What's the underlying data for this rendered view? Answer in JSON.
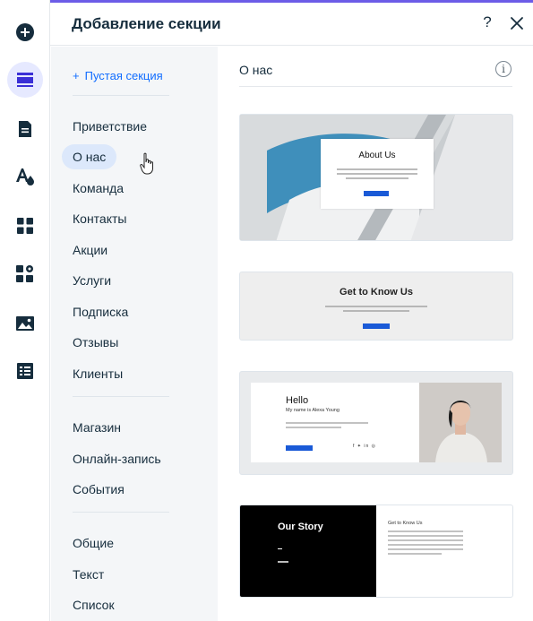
{
  "rail": {
    "items": [
      {
        "icon": "add-icon"
      },
      {
        "icon": "sections-icon",
        "active": true
      },
      {
        "icon": "page-icon"
      },
      {
        "icon": "design-icon"
      },
      {
        "icon": "apps-icon"
      },
      {
        "icon": "plugins-icon"
      },
      {
        "icon": "media-icon"
      },
      {
        "icon": "table-icon"
      }
    ]
  },
  "header": {
    "title": "Добавление секции",
    "help_label": "?"
  },
  "categories": {
    "add_empty_label": "Пустая секция",
    "add_empty_plus": "+",
    "group1": [
      "Приветствие",
      "О нас",
      "Команда",
      "Контакты",
      "Акции",
      "Услуги",
      "Подписка",
      "Отзывы",
      "Клиенты"
    ],
    "group2": [
      "Магазин",
      "Онлайн-запись",
      "События"
    ],
    "group3": [
      "Общие",
      "Текст",
      "Список"
    ],
    "selected": "О нас"
  },
  "main": {
    "title": "О нас",
    "info_label": "i",
    "thumbnails": [
      {
        "title": "About Us"
      },
      {
        "title": "Get to Know Us"
      },
      {
        "title": "Hello",
        "subtitle": "My name is Alexa Young",
        "social": "f ✦ in ◎"
      },
      {
        "title": "Our Story",
        "side_title": "Get to Know Us"
      }
    ]
  },
  "colors": {
    "accent": "#6c5ce7",
    "link": "#116dff",
    "selected_bg": "#dce8fb",
    "active_rail_bg": "#e6e9ff",
    "button_blue": "#1a5ad7"
  }
}
